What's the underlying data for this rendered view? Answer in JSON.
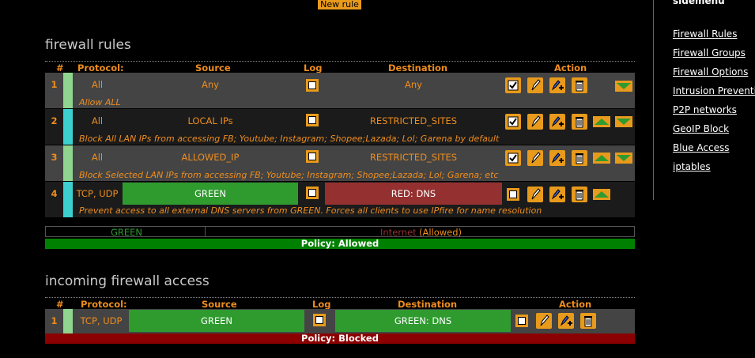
{
  "new_rule_label": "New rule",
  "firewall_section": {
    "title": "firewall rules",
    "headers": {
      "num": "#",
      "protocol": "Protocol:",
      "source": "Source",
      "log": "Log",
      "destination": "Destination",
      "action": "Action"
    },
    "rules": [
      {
        "num": "1",
        "protocol": "All",
        "source": "Any",
        "destination": "Any",
        "note": "Allow ALL",
        "stripe": "#8fd48f"
      },
      {
        "num": "2",
        "protocol": "All",
        "source": "LOCAL IPs",
        "destination": "RESTRICTED_SITES",
        "note": "Block All LAN IPs from accessing FB; Youtube; Instagram; Shopee;Lazada; Lol; Garena by default",
        "stripe": "#3ccfcf"
      },
      {
        "num": "3",
        "protocol": "All",
        "source": "ALLOWED_IP",
        "destination": "RESTRICTED_SITES",
        "note": "Block Selected LAN IPs from accessing FB; Youtube; Instagram; Shopee;Lazada; Lol; Garena; etc",
        "stripe": "#8fd48f"
      },
      {
        "num": "4",
        "protocol": "TCP, UDP",
        "source": "GREEN",
        "destination": "RED: DNS",
        "note": "Prevent access to all external DNS servers from GREEN. Forces all clients to use IPfire for name resolution",
        "stripe": "#3ccfcf"
      }
    ],
    "legend_green": "GREEN",
    "legend_internet": "Internet",
    "legend_allowed": "(Allowed)",
    "policy": "Policy: Allowed"
  },
  "incoming_section": {
    "title": "incoming firewall access",
    "headers": {
      "num": "#",
      "protocol": "Protocol:",
      "source": "Source",
      "log": "Log",
      "destination": "Destination",
      "action": "Action"
    },
    "rules": [
      {
        "num": "1",
        "protocol": "TCP, UDP",
        "source": "GREEN",
        "destination": "GREEN: DNS",
        "stripe": "#8fd48f"
      }
    ],
    "policy": "Policy: Blocked"
  },
  "sidebar": {
    "title": "sidemenu",
    "items": [
      "Firewall Rules",
      "Firewall Groups",
      "Firewall Options",
      "Intrusion Prevention",
      "P2P networks",
      "GeoIP Block",
      "Blue Access",
      "iptables"
    ]
  },
  "colors": {
    "accent": "#e89a1c",
    "green_policy": "#008000",
    "red_policy": "#8b0000"
  }
}
